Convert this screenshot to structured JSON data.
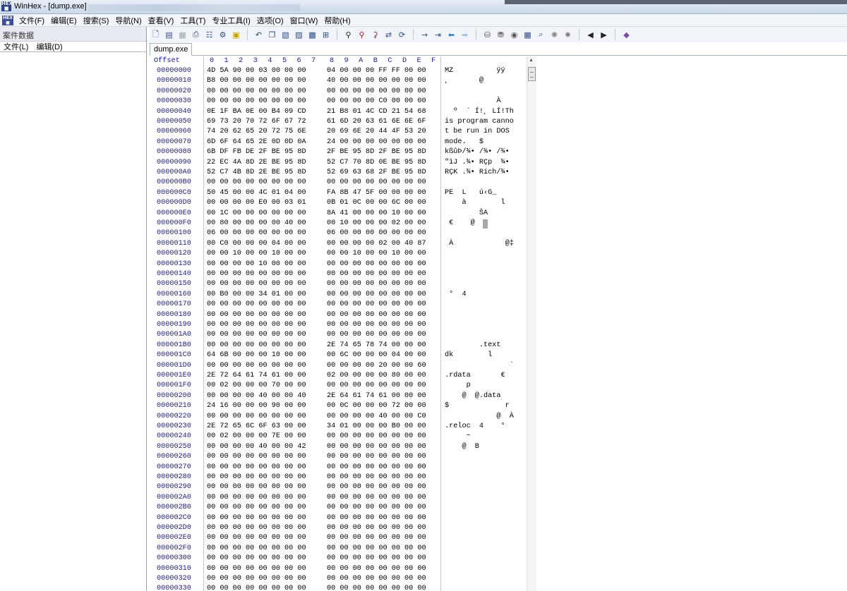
{
  "window": {
    "title": "WinHex - [dump.exe]"
  },
  "menubar": {
    "icon": "winhex-app-icon",
    "items": [
      "文件(F)",
      "编辑(E)",
      "搜索(S)",
      "导航(N)",
      "查看(V)",
      "工具(T)",
      "专业工具(I)",
      "选项(O)",
      "窗口(W)",
      "帮助(H)"
    ]
  },
  "left_panel": {
    "header": "案件数据",
    "menu": [
      "文件(L)",
      "编辑(D)"
    ]
  },
  "toolbar": {
    "icons": [
      "new-file-icon",
      "open-file-icon",
      "save-icon",
      "print-icon",
      "properties-icon",
      "options-icon",
      "separator",
      "undo-icon",
      "copy-icon",
      "cut-icon",
      "paste-icon",
      "paste-block-icon",
      "write-icon",
      "separator",
      "find-text-icon",
      "find-hex-icon",
      "replace-text-icon",
      "replace-hex-icon",
      "find-again-icon",
      "separator",
      "goto-offset-icon",
      "goto-sector-icon",
      "back-icon",
      "forward-icon",
      "separator",
      "open-disk-icon",
      "disk-editor-icon",
      "ram-editor-icon",
      "calculator-icon",
      "hash-icon",
      "search-disk-icon",
      "settings-icon",
      "separator",
      "prev-window-icon",
      "next-window-icon",
      "separator",
      "help-icon"
    ]
  },
  "tabs": [
    "dump.exe"
  ],
  "hex": {
    "header_offset": "Offset",
    "header_cols": [
      "0",
      "1",
      "2",
      "3",
      "4",
      "5",
      "6",
      "7",
      "8",
      "9",
      "A",
      "B",
      "C",
      "D",
      "E",
      "F"
    ],
    "rows": [
      {
        "offset": "00000000",
        "g1": "4D 5A 90 00 03 00 00 00",
        "g2": "04 00 00 00 FF FF 00 00",
        "ascii": "MZ          ÿÿ"
      },
      {
        "offset": "00000010",
        "g1": "B8 00 00 00 00 00 00 00",
        "g2": "40 00 00 00 00 00 00 00",
        "ascii": "¸       @"
      },
      {
        "offset": "00000020",
        "g1": "00 00 00 00 00 00 00 00",
        "g2": "00 00 00 00 00 00 00 00",
        "ascii": ""
      },
      {
        "offset": "00000030",
        "g1": "00 00 00 00 00 00 00 00",
        "g2": "00 00 00 00 C0 00 00 00",
        "ascii": "            À"
      },
      {
        "offset": "00000040",
        "g1": "0E 1F BA 0E 00 B4 09 CD",
        "g2": "21 B8 01 4C CD 21 54 68",
        "ascii": "  º  ´ Í!¸ LÍ!Th"
      },
      {
        "offset": "00000050",
        "g1": "69 73 20 70 72 6F 67 72",
        "g2": "61 6D 20 63 61 6E 6E 6F",
        "ascii": "is program canno"
      },
      {
        "offset": "00000060",
        "g1": "74 20 62 65 20 72 75 6E",
        "g2": "20 69 6E 20 44 4F 53 20",
        "ascii": "t be run in DOS "
      },
      {
        "offset": "00000070",
        "g1": "6D 6F 64 65 2E 0D 0D 0A",
        "g2": "24 00 00 00 00 00 00 00",
        "ascii": "mode.   $"
      },
      {
        "offset": "00000080",
        "g1": "6B DF FB DE 2F BE 95 8D",
        "g2": "2F BE 95 8D 2F BE 95 8D",
        "ascii": "kßûÞ/¾• /¾• /¾•"
      },
      {
        "offset": "00000090",
        "g1": "22 EC 4A 8D 2E BE 95 8D",
        "g2": "52 C7 70 8D 0E BE 95 8D",
        "ascii": "\"ìJ .¾• RÇp  ¾•"
      },
      {
        "offset": "000000A0",
        "g1": "52 C7 4B 8D 2E BE 95 8D",
        "g2": "52 69 63 68 2F BE 95 8D",
        "ascii": "RÇK .¾• Rich/¾•"
      },
      {
        "offset": "000000B0",
        "g1": "00 00 00 00 00 00 00 00",
        "g2": "00 00 00 00 00 00 00 00",
        "ascii": ""
      },
      {
        "offset": "000000C0",
        "g1": "50 45 00 00 4C 01 04 00",
        "g2": "FA 8B 47 5F 00 00 00 00",
        "ascii": "PE  L   ú‹G_"
      },
      {
        "offset": "000000D0",
        "g1": "00 00 00 00 E0 00 03 01",
        "g2": "0B 01 0C 00 00 6C 00 00",
        "ascii": "    à        l"
      },
      {
        "offset": "000000E0",
        "g1": "00 1C 00 00 00 00 00 00",
        "g2": "8A 41 00 00 00 10 00 00",
        "ascii": "        ŠA"
      },
      {
        "offset": "000000F0",
        "g1": "00 80 00 00 00 00 40 00",
        "g2": "00 10 00 00 00 02 00 00",
        "ascii": " €    @"
      },
      {
        "offset": "00000100",
        "g1": "06 00 00 00 00 00 00 00",
        "g2": "06 00 00 00 00 00 00 00",
        "ascii": ""
      },
      {
        "offset": "00000110",
        "g1": "00 C0 00 00 00 04 00 00",
        "g2": "00 00 00 00 02 00 40 87",
        "ascii": " À            @‡"
      },
      {
        "offset": "00000120",
        "g1": "00 00 10 00 00 10 00 00",
        "g2": "00 00 10 00 00 10 00 00",
        "ascii": ""
      },
      {
        "offset": "00000130",
        "g1": "00 00 00 00 10 00 00 00",
        "g2": "00 00 00 00 00 00 00 00",
        "ascii": ""
      },
      {
        "offset": "00000140",
        "g1": "00 00 00 00 00 00 00 00",
        "g2": "00 00 00 00 00 00 00 00",
        "ascii": ""
      },
      {
        "offset": "00000150",
        "g1": "00 00 00 00 00 00 00 00",
        "g2": "00 00 00 00 00 00 00 00",
        "ascii": ""
      },
      {
        "offset": "00000160",
        "g1": "00 B0 00 00 34 01 00 00",
        "g2": "00 00 00 00 00 00 00 00",
        "ascii": " °  4"
      },
      {
        "offset": "00000170",
        "g1": "00 00 00 00 00 00 00 00",
        "g2": "00 00 00 00 00 00 00 00",
        "ascii": ""
      },
      {
        "offset": "00000180",
        "g1": "00 00 00 00 00 00 00 00",
        "g2": "00 00 00 00 00 00 00 00",
        "ascii": ""
      },
      {
        "offset": "00000190",
        "g1": "00 00 00 00 00 00 00 00",
        "g2": "00 00 00 00 00 00 00 00",
        "ascii": ""
      },
      {
        "offset": "000001A0",
        "g1": "00 00 00 00 00 00 00 00",
        "g2": "00 00 00 00 00 00 00 00",
        "ascii": ""
      },
      {
        "offset": "000001B0",
        "g1": "00 00 00 00 00 00 00 00",
        "g2": "2E 74 65 78 74 00 00 00",
        "ascii": "        .text"
      },
      {
        "offset": "000001C0",
        "g1": "64 6B 00 00 00 10 00 00",
        "g2": "00 6C 00 00 00 04 00 00",
        "ascii": "dk        l"
      },
      {
        "offset": "000001D0",
        "g1": "00 00 00 00 00 00 00 00",
        "g2": "00 00 00 00 20 00 00 60",
        "ascii": "               `"
      },
      {
        "offset": "000001E0",
        "g1": "2E 72 64 61 74 61 00 00",
        "g2": "02 00 00 00 00 80 00 00",
        "ascii": ".rdata       €"
      },
      {
        "offset": "000001F0",
        "g1": "00 02 00 00 00 70 00 00",
        "g2": "00 00 00 00 00 00 00 00",
        "ascii": "     p"
      },
      {
        "offset": "00000200",
        "g1": "00 00 00 00 40 00 00 40",
        "g2": "2E 64 61 74 61 00 00 00",
        "ascii": "    @  @.data"
      },
      {
        "offset": "00000210",
        "g1": "24 16 00 00 00 90 00 00",
        "g2": "00 0C 00 00 00 72 00 00",
        "ascii": "$             r"
      },
      {
        "offset": "00000220",
        "g1": "00 00 00 00 00 00 00 00",
        "g2": "00 00 00 00 40 00 00 C0",
        "ascii": "            @  À"
      },
      {
        "offset": "00000230",
        "g1": "2E 72 65 6C 6F 63 00 00",
        "g2": "34 01 00 00 00 B0 00 00",
        "ascii": ".reloc  4    °"
      },
      {
        "offset": "00000240",
        "g1": "00 02 00 00 00 7E 00 00",
        "g2": "00 00 00 00 00 00 00 00",
        "ascii": "     ~"
      },
      {
        "offset": "00000250",
        "g1": "00 00 00 00 40 00 00 42",
        "g2": "00 00 00 00 00 00 00 00",
        "ascii": "    @  B"
      },
      {
        "offset": "00000260",
        "g1": "00 00 00 00 00 00 00 00",
        "g2": "00 00 00 00 00 00 00 00",
        "ascii": ""
      },
      {
        "offset": "00000270",
        "g1": "00 00 00 00 00 00 00 00",
        "g2": "00 00 00 00 00 00 00 00",
        "ascii": ""
      },
      {
        "offset": "00000280",
        "g1": "00 00 00 00 00 00 00 00",
        "g2": "00 00 00 00 00 00 00 00",
        "ascii": ""
      },
      {
        "offset": "00000290",
        "g1": "00 00 00 00 00 00 00 00",
        "g2": "00 00 00 00 00 00 00 00",
        "ascii": ""
      },
      {
        "offset": "000002A0",
        "g1": "00 00 00 00 00 00 00 00",
        "g2": "00 00 00 00 00 00 00 00",
        "ascii": ""
      },
      {
        "offset": "000002B0",
        "g1": "00 00 00 00 00 00 00 00",
        "g2": "00 00 00 00 00 00 00 00",
        "ascii": ""
      },
      {
        "offset": "000002C0",
        "g1": "00 00 00 00 00 00 00 00",
        "g2": "00 00 00 00 00 00 00 00",
        "ascii": ""
      },
      {
        "offset": "000002D0",
        "g1": "00 00 00 00 00 00 00 00",
        "g2": "00 00 00 00 00 00 00 00",
        "ascii": ""
      },
      {
        "offset": "000002E0",
        "g1": "00 00 00 00 00 00 00 00",
        "g2": "00 00 00 00 00 00 00 00",
        "ascii": ""
      },
      {
        "offset": "000002F0",
        "g1": "00 00 00 00 00 00 00 00",
        "g2": "00 00 00 00 00 00 00 00",
        "ascii": ""
      },
      {
        "offset": "00000300",
        "g1": "00 00 00 00 00 00 00 00",
        "g2": "00 00 00 00 00 00 00 00",
        "ascii": ""
      },
      {
        "offset": "00000310",
        "g1": "00 00 00 00 00 00 00 00",
        "g2": "00 00 00 00 00 00 00 00",
        "ascii": ""
      },
      {
        "offset": "00000320",
        "g1": "00 00 00 00 00 00 00 00",
        "g2": "00 00 00 00 00 00 00 00",
        "ascii": ""
      },
      {
        "offset": "00000330",
        "g1": "00 00 00 00 00 00 00 00",
        "g2": "00 00 00 00 00 00 00 00",
        "ascii": ""
      }
    ]
  }
}
